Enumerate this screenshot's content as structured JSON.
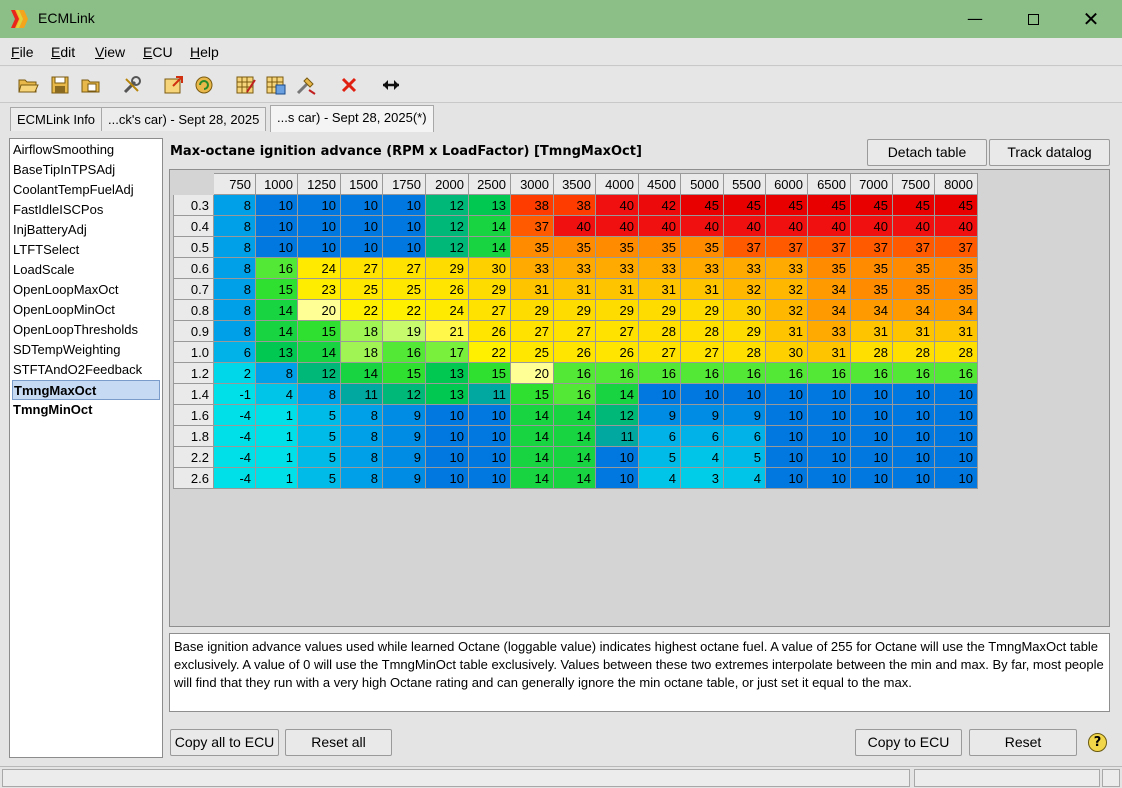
{
  "window": {
    "title": "ECMLink",
    "minimize_icon": "minimize-icon",
    "maximize_icon": "maximize-icon",
    "close_icon": "close-icon"
  },
  "menu": [
    "File",
    "Edit",
    "View",
    "ECU",
    "Help"
  ],
  "toolbar_icons": [
    "open-folder-icon",
    "save-icon",
    "open-folder-alt-icon",
    "tools-icon",
    "export-icon",
    "refresh-icon",
    "table-edit-icon",
    "table-compare-icon",
    "tuning-icon",
    "delete-icon",
    "swap-arrows-icon"
  ],
  "tabs": [
    {
      "label": "ECMLink Info"
    },
    {
      "label": "...ck's car) - Sept 28, 2025"
    },
    {
      "label": "...s car) - Sept 28, 2025(*)"
    }
  ],
  "tables_list": [
    {
      "label": "AirflowSmoothing",
      "bold": false,
      "selected": false
    },
    {
      "label": "BaseTipInTPSAdj",
      "bold": false,
      "selected": false
    },
    {
      "label": "CoolantTempFuelAdj",
      "bold": false,
      "selected": false
    },
    {
      "label": "FastIdleISCPos",
      "bold": false,
      "selected": false
    },
    {
      "label": "InjBatteryAdj",
      "bold": false,
      "selected": false
    },
    {
      "label": "LTFTSelect",
      "bold": false,
      "selected": false
    },
    {
      "label": "LoadScale",
      "bold": false,
      "selected": false
    },
    {
      "label": "OpenLoopMaxOct",
      "bold": false,
      "selected": false
    },
    {
      "label": "OpenLoopMinOct",
      "bold": false,
      "selected": false
    },
    {
      "label": "OpenLoopThresholds",
      "bold": false,
      "selected": false
    },
    {
      "label": "SDTempWeighting",
      "bold": false,
      "selected": false
    },
    {
      "label": "STFTAndO2Feedback",
      "bold": false,
      "selected": false
    },
    {
      "label": "TmngMaxOct",
      "bold": true,
      "selected": true
    },
    {
      "label": "TmngMinOct",
      "bold": true,
      "selected": false
    }
  ],
  "table": {
    "title": "Max-octane ignition advance (RPM x LoadFactor) [TmngMaxOct]",
    "detach_label": "Detach table",
    "track_label": "Track datalog",
    "rpm": [
      "750",
      "1000",
      "1250",
      "1500",
      "1750",
      "2000",
      "2500",
      "3000",
      "3500",
      "4000",
      "4500",
      "5000",
      "5500",
      "6000",
      "6500",
      "7000",
      "7500",
      "8000"
    ],
    "load": [
      "0.3",
      "0.4",
      "0.5",
      "0.6",
      "0.7",
      "0.8",
      "0.9",
      "1.0",
      "1.2",
      "1.4",
      "1.6",
      "1.8",
      "2.2",
      "2.6"
    ],
    "values": [
      [
        8,
        10,
        10,
        10,
        10,
        12,
        13,
        38,
        38,
        40,
        42,
        45,
        45,
        45,
        45,
        45,
        45,
        45
      ],
      [
        8,
        10,
        10,
        10,
        10,
        12,
        14,
        37,
        40,
        40,
        40,
        40,
        40,
        40,
        40,
        40,
        40,
        40
      ],
      [
        8,
        10,
        10,
        10,
        10,
        12,
        14,
        35,
        35,
        35,
        35,
        35,
        37,
        37,
        37,
        37,
        37,
        37
      ],
      [
        8,
        16,
        24,
        27,
        27,
        29,
        30,
        33,
        33,
        33,
        33,
        33,
        33,
        33,
        35,
        35,
        35,
        35
      ],
      [
        8,
        15,
        23,
        25,
        25,
        26,
        29,
        31,
        31,
        31,
        31,
        31,
        32,
        32,
        34,
        35,
        35,
        35
      ],
      [
        8,
        14,
        20,
        22,
        22,
        24,
        27,
        29,
        29,
        29,
        29,
        29,
        30,
        32,
        34,
        34,
        34,
        34
      ],
      [
        8,
        14,
        15,
        18,
        19,
        21,
        26,
        27,
        27,
        27,
        28,
        28,
        29,
        31,
        33,
        31,
        31,
        31
      ],
      [
        6,
        13,
        14,
        18,
        16,
        17,
        22,
        25,
        26,
        26,
        27,
        27,
        28,
        30,
        31,
        28,
        28,
        28
      ],
      [
        2,
        8,
        12,
        14,
        15,
        13,
        15,
        20,
        16,
        16,
        16,
        16,
        16,
        16,
        16,
        16,
        16,
        16
      ],
      [
        -1,
        4,
        8,
        11,
        12,
        13,
        11,
        15,
        16,
        14,
        10,
        10,
        10,
        10,
        10,
        10,
        10,
        10
      ],
      [
        -4,
        1,
        5,
        8,
        9,
        10,
        10,
        14,
        14,
        12,
        9,
        9,
        9,
        10,
        10,
        10,
        10,
        10
      ],
      [
        -4,
        1,
        5,
        8,
        9,
        10,
        10,
        14,
        14,
        11,
        6,
        6,
        6,
        10,
        10,
        10,
        10,
        10
      ],
      [
        -4,
        1,
        5,
        8,
        9,
        10,
        10,
        14,
        14,
        10,
        5,
        4,
        5,
        10,
        10,
        10,
        10,
        10
      ],
      [
        -4,
        1,
        5,
        8,
        9,
        10,
        10,
        14,
        14,
        10,
        4,
        3,
        4,
        10,
        10,
        10,
        10,
        10
      ]
    ]
  },
  "description": "Base ignition advance values used while learned Octane (loggable value) indicates highest octane fuel.  A value of 255 for Octane will use the TmngMaxOct table exclusively.  A value of 0 will use the TmngMinOct table exclusively.  Values between these two extremes interpolate between the min and max.  By far, most people will find that they run with a very high Octane rating and can generally ignore the min octane table, or just set it equal to the max.",
  "buttons": {
    "copy_all": "Copy all to ECU",
    "reset_all": "Reset all",
    "copy": "Copy to ECU",
    "reset": "Reset"
  },
  "help_icon": "?"
}
